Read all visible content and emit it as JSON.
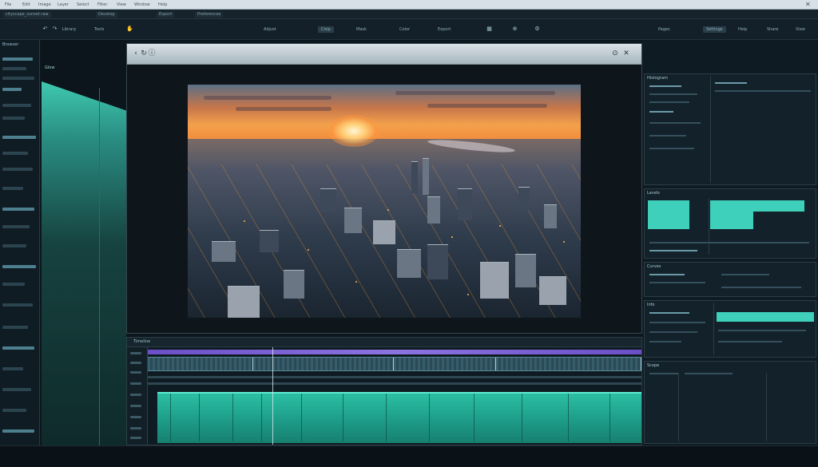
{
  "menubar": {
    "items": [
      "File",
      "Edit",
      "Image",
      "Layer",
      "Select",
      "Filter",
      "View",
      "Window",
      "Help"
    ]
  },
  "tabbar": {
    "tabs": [
      "cityscape_sunset.raw",
      "Develop",
      "Export",
      "Preferences"
    ]
  },
  "toolbar": {
    "left_items": [
      "Library",
      "Tools"
    ],
    "center_items": [
      "Adjust",
      "Crop",
      "Mask",
      "Color",
      "Export"
    ],
    "right_items": [
      "Pages",
      "Settings",
      "Help",
      "Share",
      "View"
    ]
  },
  "left_panel": {
    "title": "Browser"
  },
  "strip": {
    "label": "Glow"
  },
  "viewer": {
    "title_icons": [
      "back-icon",
      "refresh-icon",
      "lock-icon",
      "close-icon"
    ]
  },
  "timeline": {
    "header": "Timeline"
  },
  "right_panels": {
    "histogram": "Histogram",
    "levels": "Levels",
    "curves": "Curves",
    "info": "Info",
    "scope": "Scope"
  },
  "colors": {
    "accent_teal": "#3fd0bb",
    "accent_purple": "#7b60d4",
    "sunset_orange": "#f3a14c"
  }
}
